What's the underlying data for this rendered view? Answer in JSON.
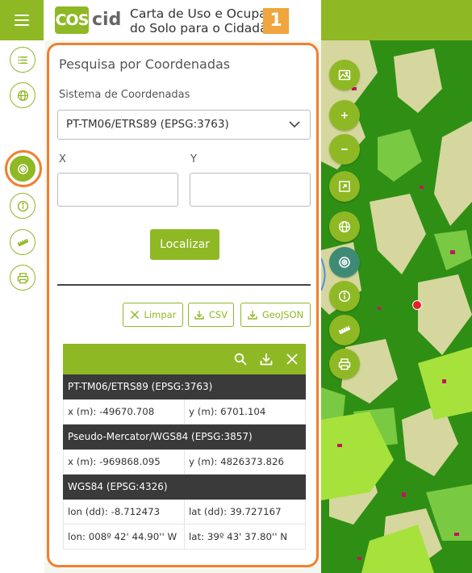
{
  "header": {
    "logo_text": "COS",
    "logo_suffix": "cid",
    "title": "Carta de Uso e Ocupação\ndo Solo para o Cidadão",
    "step_badge": "1"
  },
  "left_toolbar": {
    "items": [
      {
        "name": "layers-list-icon",
        "active": false
      },
      {
        "name": "globe-icon",
        "active": false
      },
      {
        "name": "target-icon",
        "active": true
      },
      {
        "name": "info-icon",
        "active": false
      },
      {
        "name": "ruler-icon",
        "active": false
      },
      {
        "name": "print-icon",
        "active": false
      }
    ]
  },
  "panel": {
    "title": "Pesquisa por Coordenadas",
    "crs_label": "Sistema de Coordenadas",
    "crs_selected": "PT-TM06/ETRS89 (EPSG:3763)",
    "x_label": "X",
    "y_label": "Y",
    "x_value": "",
    "y_value": "",
    "locate_label": "Localizar",
    "clear_label": "Limpar",
    "csv_label": "CSV",
    "geojson_label": "GeoJSON"
  },
  "results": {
    "sections": [
      {
        "title": "PT-TM06/ETRS89 (EPSG:3763)",
        "rows": [
          [
            "x (m): -49670.708",
            "y (m): 6701.104"
          ]
        ]
      },
      {
        "title": "Pseudo-Mercator/WGS84 (EPSG:3857)",
        "rows": [
          [
            "x (m): -969868.095",
            "y (m): 4826373.826"
          ]
        ]
      },
      {
        "title": "WGS84 (EPSG:4326)",
        "rows": [
          [
            "lon (dd): -8.712473",
            "lat (dd): 39.727167"
          ],
          [
            "lon: 008º 42' 44.90'' W",
            "lat: 39º 43' 37.80'' N"
          ]
        ]
      }
    ]
  },
  "map_toolbar": {
    "items": [
      {
        "name": "basemap-icon",
        "active": false
      },
      {
        "name": "zoom-in-icon",
        "active": false
      },
      {
        "name": "zoom-out-icon",
        "active": false
      },
      {
        "name": "fullscreen-icon",
        "active": false
      },
      {
        "name": "globe-icon",
        "active": false
      },
      {
        "name": "target-icon",
        "active": true
      },
      {
        "name": "info-icon",
        "active": false
      },
      {
        "name": "ruler-icon",
        "active": false
      },
      {
        "name": "print-icon",
        "active": false
      }
    ]
  },
  "colors": {
    "brand_green": "#8fb825",
    "highlight_orange": "#f08030",
    "section_dark": "#3a3a3a",
    "marker_red": "#e81d2a"
  }
}
